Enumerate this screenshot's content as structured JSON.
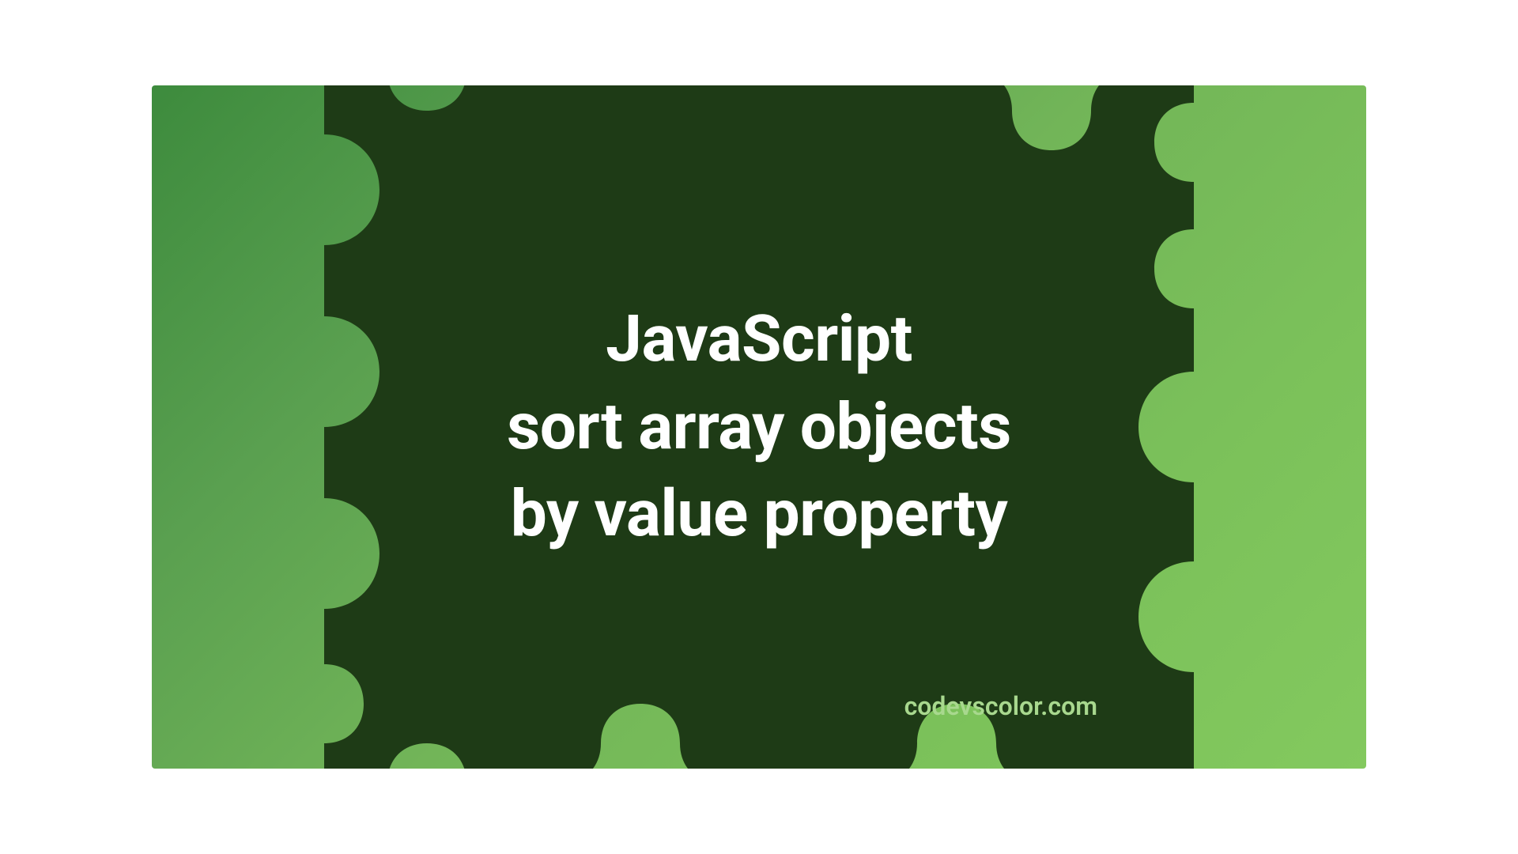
{
  "title": {
    "line1": "JavaScript",
    "line2": "sort array objects",
    "line3": "by value property"
  },
  "watermark": "codevscolor.com",
  "colors": {
    "bgGradientStart": "#3d8b3d",
    "bgGradientEnd": "#83c95e",
    "blobFill": "#1e3b16",
    "titleText": "#ffffff",
    "watermarkText": "#a8d88e"
  }
}
